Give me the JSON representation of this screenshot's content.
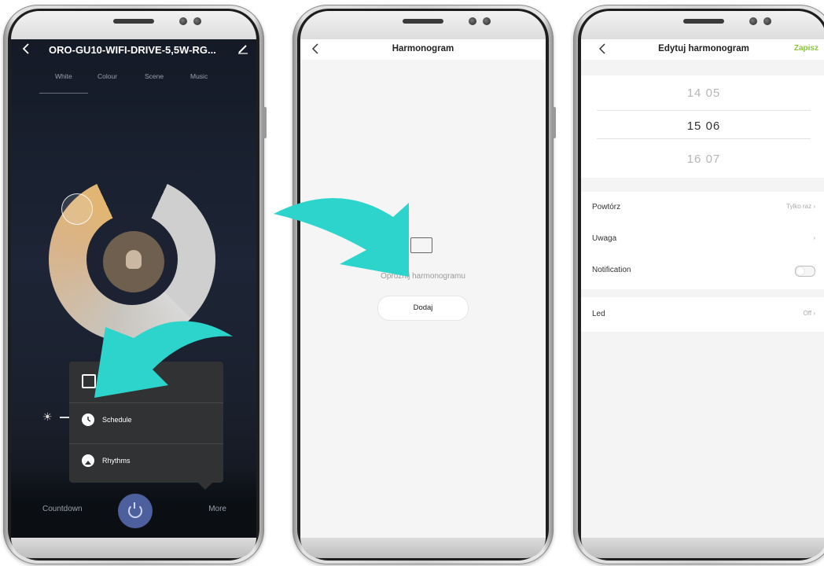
{
  "phone1": {
    "device_title": "ORO-GU10-WIFI-DRIVE-5,5W-RG...",
    "tabs": [
      "White",
      "Colour",
      "Scene",
      "Music"
    ],
    "popup": {
      "items": [
        {
          "label": "Schedule",
          "icon": "clock-icon"
        },
        {
          "label": "Rhythms",
          "icon": "rhythms-icon"
        }
      ]
    },
    "bottom": {
      "countdown_label": "Countdown",
      "more_label": "More"
    }
  },
  "phone2": {
    "title": "Harmonogram",
    "empty_text": "Opróżnij harmonogramu",
    "add_label": "Dodaj"
  },
  "phone3": {
    "title": "Edytuj harmonogram",
    "save_label": "Zapisz",
    "picker": [
      {
        "hour": "14",
        "minute": "05"
      },
      {
        "hour": "15",
        "minute": "06"
      },
      {
        "hour": "16",
        "minute": "07"
      }
    ],
    "settings": [
      {
        "label": "Powtórz",
        "value": "Tylko raz",
        "chevron": true
      },
      {
        "label": "Uwaga",
        "value": "",
        "chevron": true
      },
      {
        "label": "Notification",
        "value": "",
        "toggle": true,
        "enabled": false
      }
    ],
    "led": {
      "label": "Led",
      "value": "Off"
    }
  },
  "colors": {
    "accent_arrow": "#2dd4cc",
    "save_green": "#8cc63f",
    "power_button": "#4d5f9c"
  }
}
